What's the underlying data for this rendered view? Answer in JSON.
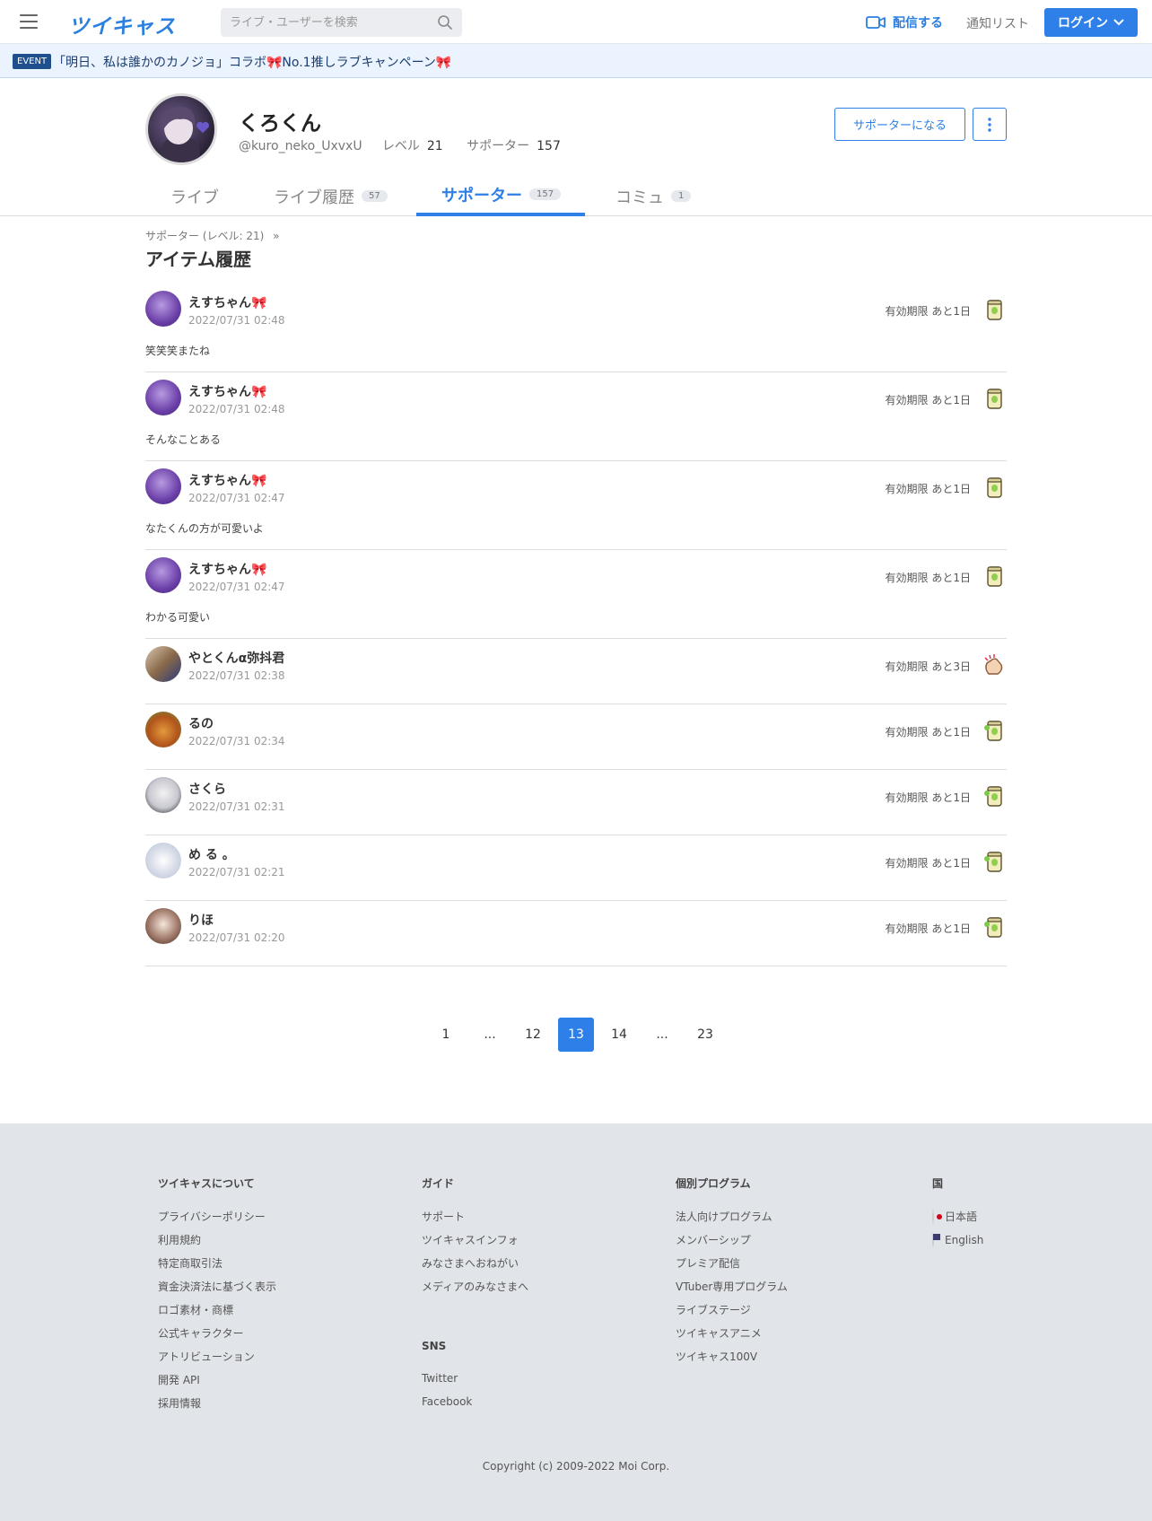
{
  "header": {
    "logo": "ツイキャス",
    "search_placeholder": "ライブ・ユーザーを検索",
    "stream_label": "配信する",
    "notify_label": "通知リスト",
    "login_label": "ログイン"
  },
  "event": {
    "badge": "EVENT",
    "text": "「明日、私は誰かのカノジョ」コラボ🎀No.1推しラブキャンペーン🎀"
  },
  "profile": {
    "name": "くろくん",
    "handle": "@kuro_neko_UxvxU",
    "level_label": "レベル",
    "level": "21",
    "supporter_label": "サポーター",
    "supporters": "157",
    "support_button": "サポーターになる"
  },
  "tabs": [
    {
      "label": "ライブ",
      "count": ""
    },
    {
      "label": "ライブ履歴",
      "count": "57"
    },
    {
      "label": "サポーター",
      "count": "157"
    },
    {
      "label": "コミュ",
      "count": "1"
    }
  ],
  "breadcrumb": "サポーター (レベル: 21)",
  "breadcrumb_arrow": "»",
  "page_title": "アイテム履歴",
  "items": [
    {
      "user": "えすちゃん🎀",
      "date": "2022/07/31 02:48",
      "expire": "有効期限 あと1日",
      "message": "笑笑笑またね",
      "gift": "tea-can-icon"
    },
    {
      "user": "えすちゃん🎀",
      "date": "2022/07/31 02:48",
      "expire": "有効期限 あと1日",
      "message": "そんなことある",
      "gift": "tea-can-icon"
    },
    {
      "user": "えすちゃん🎀",
      "date": "2022/07/31 02:47",
      "expire": "有効期限 あと1日",
      "message": "なたくんの方が可愛いよ",
      "gift": "tea-can-icon"
    },
    {
      "user": "えすちゃん🎀",
      "date": "2022/07/31 02:47",
      "expire": "有効期限 あと1日",
      "message": "わかる可愛い",
      "gift": "tea-can-icon"
    },
    {
      "user": "やとくんα弥抖君",
      "date": "2022/07/31 02:38",
      "expire": "有効期限 あと3日",
      "message": "",
      "gift": "clap-icon"
    },
    {
      "user": "るの",
      "date": "2022/07/31 02:34",
      "expire": "有効期限 あと1日",
      "message": "",
      "gift": "tea-can-icon"
    },
    {
      "user": "さくら",
      "date": "2022/07/31 02:31",
      "expire": "有効期限 あと1日",
      "message": "",
      "gift": "tea-can-icon"
    },
    {
      "user": "め る 。",
      "date": "2022/07/31 02:21",
      "expire": "有効期限 あと1日",
      "message": "",
      "gift": "tea-can-icon"
    },
    {
      "user": "りほ",
      "date": "2022/07/31 02:20",
      "expire": "有効期限 あと1日",
      "message": "",
      "gift": "tea-can-icon"
    }
  ],
  "pagination": [
    "1",
    "...",
    "12",
    "13",
    "14",
    "...",
    "23"
  ],
  "current_page": "13",
  "footer": {
    "about_title": "ツイキャスについて",
    "about_links": [
      "プライバシーポリシー",
      "利用規約",
      "特定商取引法",
      "資金決済法に基づく表示",
      "ロゴ素材・商標",
      "公式キャラクター",
      "アトリビューション",
      "開発 API",
      "採用情報"
    ],
    "guide_title": "ガイド",
    "guide_links": [
      "サポート",
      "ツイキャスインフォ",
      "みなさまへおねがい",
      "メディアのみなさまへ"
    ],
    "sns_title": "SNS",
    "sns_links": [
      "Twitter",
      "Facebook"
    ],
    "program_title": "個別プログラム",
    "program_links": [
      "法人向けプログラム",
      "メンバーシップ",
      "プレミア配信",
      "VTuber専用プログラム",
      "ライブステージ",
      "ツイキャスアニメ",
      "ツイキャス100V"
    ],
    "country_title": "国",
    "languages": [
      "日本語",
      "English"
    ],
    "copyright": "Copyright (c) 2009-2022 Moi Corp."
  },
  "colors": {
    "accent": "#2e7fe8",
    "event_bg": "#eaf3fe",
    "footer_bg": "#e1e4e8"
  }
}
